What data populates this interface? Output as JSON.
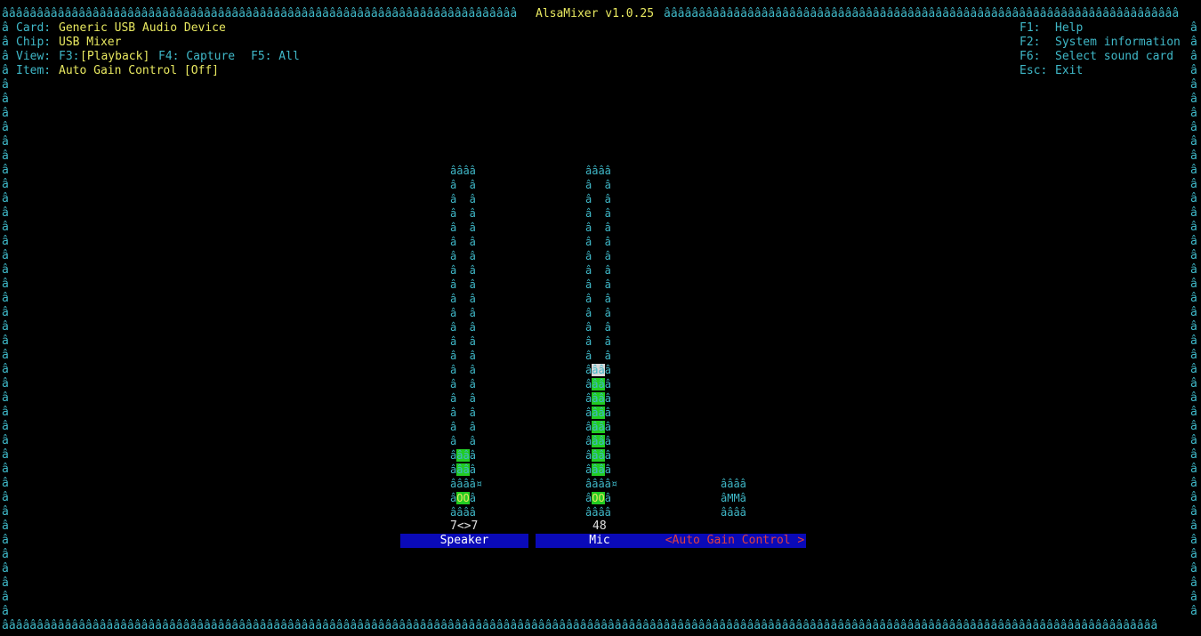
{
  "title_bar": {
    "title": "AlsaMixer v1.0.25",
    "border_char": "â"
  },
  "info": {
    "card_label": "Card:",
    "card_value": "Generic USB Audio Device",
    "chip_label": "Chip:",
    "chip_value": "USB Mixer",
    "view_label": "View:",
    "view_f3": "F3:",
    "view_playback": "[Playback]",
    "view_f4": "F4: Capture",
    "view_f5": "F5: All",
    "item_label": "Item:",
    "item_value": "Auto Gain Control [Off]"
  },
  "keys": [
    {
      "key": "F1:",
      "action": "Help"
    },
    {
      "key": "F2:",
      "action": "System information"
    },
    {
      "key": "F6:",
      "action": "Select sound card"
    },
    {
      "key": "Esc:",
      "action": "Exit"
    }
  ],
  "controls": [
    {
      "name": "Speaker",
      "value_text": "7<>7",
      "mute_text": "OO",
      "level": 0.1
    },
    {
      "name": "Mic",
      "value_text": "48",
      "mute_text": "OO",
      "level": 0.4
    },
    {
      "name": "<Auto Gain Control >",
      "value_text": "",
      "mute_text": "MM",
      "level": 0
    }
  ],
  "colors": {
    "background": "#000000",
    "border": "#3fb8c8",
    "title": "#e8e860",
    "bar_fill": "#22cc22",
    "label_bg": "#0a0ab8",
    "selected_label": "#e04040"
  }
}
